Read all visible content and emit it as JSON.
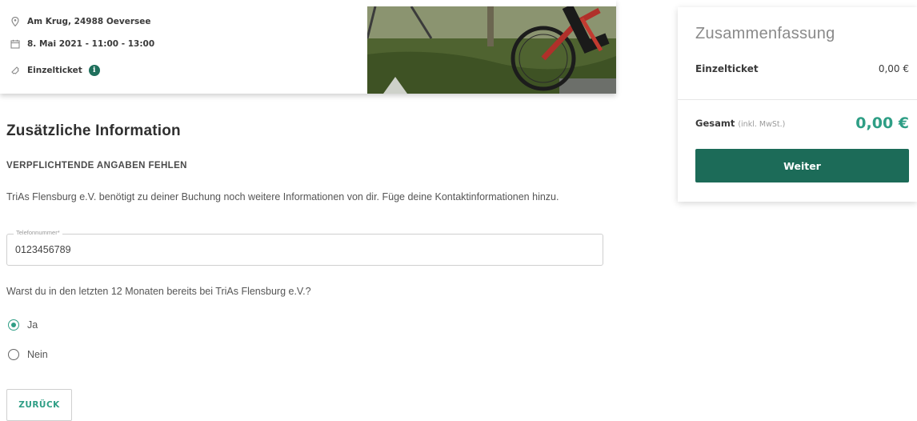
{
  "event": {
    "location": "Am Krug, 24988 Oeversee",
    "date": "8. Mai 2021 - 11:00 - 13:00",
    "ticket": "Einzelticket",
    "location_icon": "map-pin-icon",
    "date_icon": "calendar-icon",
    "ticket_icon": "ticket-icon",
    "info_icon": "info-icon",
    "info_glyph": "i"
  },
  "summary": {
    "title": "Zusammenfassung",
    "item_label": "Einzelticket",
    "item_price": "0,00 €",
    "total_label": "Gesamt",
    "total_note": "(inkl. MwSt.)",
    "total_amount": "0,00 €",
    "continue_label": "Weiter"
  },
  "form": {
    "section_title": "Zusätzliche Information",
    "warning": "VERPFLICHTENDE ANGABEN FEHLEN",
    "description": "TriAs Flensburg e.V. benötigt zu deiner Buchung noch weitere Informationen von dir. Füge deine Kontaktinformationen hinzu.",
    "phone_label": "Telefonnummer*",
    "phone_value": "0123456789",
    "question": "Warst du in den letzten 12 Monaten bereits bei TriAs Flensburg e.V.?",
    "options": [
      {
        "label": "Ja",
        "selected": true
      },
      {
        "label": "Nein",
        "selected": false
      }
    ],
    "back_label": "ZURÜCK"
  },
  "colors": {
    "accent": "#2e9e85",
    "button": "#1c6b58",
    "info": "#1f6f5c"
  }
}
